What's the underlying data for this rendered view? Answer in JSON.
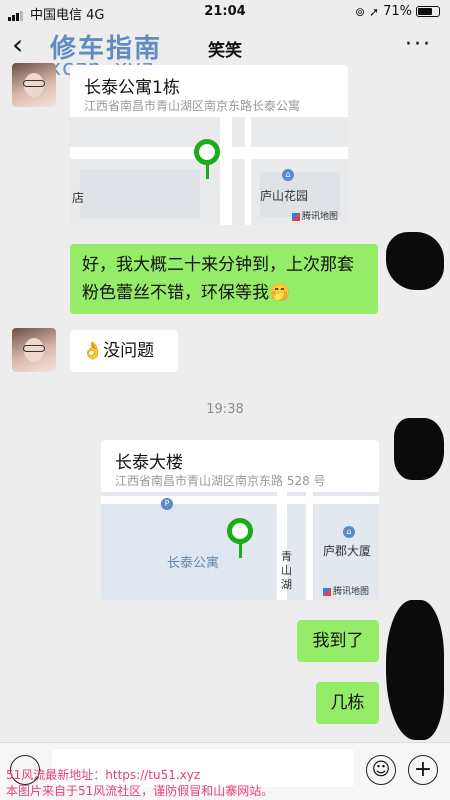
{
  "status_bar": {
    "carrier": "中国电信",
    "network": "4G",
    "time": "21:04",
    "battery": "71%",
    "battery_level": 0.71
  },
  "nav": {
    "back": "‹",
    "title": "笑笑",
    "more": "···"
  },
  "watermark": {
    "brand": "修车指南",
    "domain": "xczn.xyz"
  },
  "messages": {
    "loc1": {
      "name": "长泰公寓1栋",
      "address": "江西省南昌市青山湖区南京东路长泰公寓",
      "poi": "庐山花园",
      "edge_label": "店",
      "provider": "腾讯地图"
    },
    "msg1": {
      "text": "好，我大概二十来分钟到，上次那套粉色蕾丝不错，环保等我🤭"
    },
    "msg2": {
      "emoji": "👌",
      "text": "没问题"
    },
    "timestamp": "19:38",
    "loc2": {
      "name": "长泰大楼",
      "address": "江西省南昌市青山湖区南京东路 528 号",
      "poi": "庐郡大厦",
      "area_label": "长泰公寓",
      "road_label": "青山湖",
      "provider": "腾讯地图"
    },
    "msg3": {
      "text": "我到了"
    },
    "msg4": {
      "text": "几栋"
    }
  },
  "input_bar": {
    "emoji_icon": "☺",
    "plus_icon": "+"
  },
  "overlay": {
    "line1": "51风流最新地址：https://tu51.xyz",
    "line2": "本图片来自于51风流社区，谨防假冒和山寨网站。"
  }
}
